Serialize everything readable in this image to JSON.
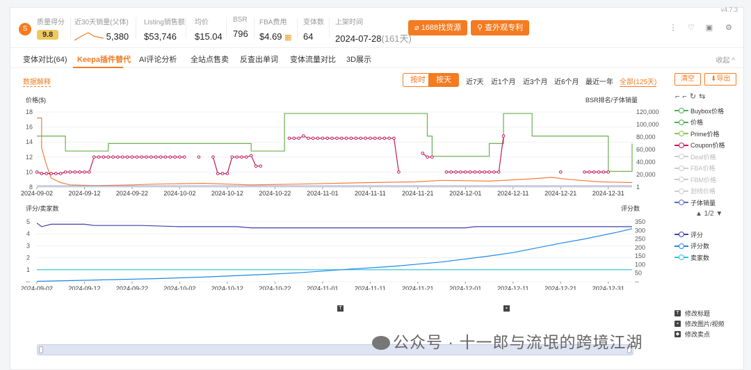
{
  "version": "v4.7.3",
  "stats": {
    "quality": {
      "label": "质量得分",
      "value": "9.8"
    },
    "sales30": {
      "label": "近30天销量(父体)",
      "value": "5,380"
    },
    "listing_sales": {
      "label": "Listing销售额",
      "value": "$53,746"
    },
    "avg_price": {
      "label": "均价",
      "value": "$15.04"
    },
    "bsr": {
      "label": "BSR",
      "value": "796"
    },
    "fba": {
      "label": "FBA费用",
      "value": "$4.69"
    },
    "variants": {
      "label": "变体数",
      "value": "64"
    },
    "launch": {
      "label": "上架时间",
      "value": "2024-07-28",
      "days": "(161天)"
    }
  },
  "buttons": {
    "source": "1688找货源",
    "patent": "查外观专利"
  },
  "icons": [
    "more-icon",
    "heart-icon",
    "video-icon",
    "settings-icon"
  ],
  "tabs": [
    {
      "label": "变体对比(64)",
      "active": false
    },
    {
      "label": "Keepa插件替代",
      "active": true
    },
    {
      "label": "AI评论分析",
      "active": false
    },
    {
      "label": "全站点售卖",
      "active": false
    },
    {
      "label": "反查出单词",
      "active": false
    },
    {
      "label": "变体流量对比",
      "active": false
    },
    {
      "label": "3D展示",
      "active": false
    }
  ],
  "collapse": "收起 ^",
  "toolbar": {
    "data_explain": "数据解释",
    "by_hour": "按时",
    "by_day": "按天",
    "ranges": [
      "近7天",
      "近1个月",
      "近3个月",
      "近6个月",
      "最近一年",
      "全部(125天)"
    ],
    "clear": "清空",
    "export": "导出"
  },
  "chart_data": [
    {
      "type": "line",
      "ylabel": "价格($)",
      "y2label": "BSR排名/子体销量",
      "ylim": [
        8,
        18
      ],
      "y_ticks": [
        8,
        10,
        12,
        14,
        16,
        18
      ],
      "y2_ticks": [
        "1",
        "20,000",
        "40,000",
        "60,000",
        "80,000",
        "100,000",
        "120,000"
      ],
      "x_ticks": [
        "2024-09-02",
        "2024-09-12",
        "2024-09-22",
        "2024-10-02",
        "2024-10-12",
        "2024-10-22",
        "2024-11-01",
        "2024-11-11",
        "2024-11-21",
        "2024-12-01",
        "2024-12-11",
        "2024-12-21",
        "2024-12-31"
      ],
      "series": [
        {
          "name": "Buybox价格",
          "color": "#4caf50",
          "visible": true
        },
        {
          "name": "价格",
          "color": "#4caf50",
          "visible": true
        },
        {
          "name": "Prime价格",
          "color": "#8bc34a",
          "visible": true
        },
        {
          "name": "Coupon价格",
          "color": "#c2185b",
          "visible": true
        },
        {
          "name": "Deal价格",
          "color": "#bbbbbb",
          "visible": false
        },
        {
          "name": "FBA价格",
          "color": "#bbbbbb",
          "visible": false
        },
        {
          "name": "FBM价格",
          "color": "#bbbbbb",
          "visible": false
        },
        {
          "name": "划线价格",
          "color": "#bbbbbb",
          "visible": false
        },
        {
          "name": "子体销量",
          "color": "#5c6bc0",
          "visible": true
        }
      ],
      "green_price": [
        [
          0,
          14.8
        ],
        [
          6,
          14.8
        ],
        [
          6,
          12.8
        ],
        [
          15,
          12.8
        ],
        [
          15,
          13.8
        ],
        [
          45,
          13.8
        ],
        [
          45,
          12.8
        ],
        [
          52,
          12.8
        ],
        [
          52,
          17.8
        ],
        [
          82,
          17.8
        ],
        [
          82,
          14.8
        ],
        [
          83,
          14.8
        ],
        [
          83,
          12.1
        ],
        [
          95,
          12.1
        ],
        [
          95,
          13.8
        ],
        [
          98,
          13.8
        ],
        [
          98,
          17.8
        ],
        [
          104,
          17.8
        ],
        [
          104,
          14.8
        ],
        [
          120,
          14.8
        ],
        [
          120,
          10.1
        ],
        [
          125,
          10.1
        ],
        [
          125,
          13.8
        ]
      ],
      "coupon_segments": [
        [
          [
            0,
            10
          ],
          [
            1,
            9.8
          ],
          [
            2,
            9.8
          ],
          [
            3,
            9.8
          ],
          [
            4,
            9.8
          ],
          [
            5,
            9.8
          ],
          [
            6,
            10
          ],
          [
            7,
            10
          ],
          [
            8,
            10
          ],
          [
            9,
            10
          ],
          [
            10,
            10
          ],
          [
            11,
            10
          ],
          [
            12,
            12
          ],
          [
            13,
            12
          ],
          [
            14,
            12
          ],
          [
            15,
            12
          ],
          [
            16,
            12
          ],
          [
            17,
            12
          ],
          [
            18,
            12
          ],
          [
            19,
            12
          ],
          [
            20,
            12
          ],
          [
            21,
            12
          ],
          [
            22,
            12
          ],
          [
            23,
            12
          ],
          [
            24,
            12
          ],
          [
            25,
            12
          ],
          [
            26,
            12
          ],
          [
            27,
            12
          ],
          [
            28,
            12
          ],
          [
            29,
            12
          ],
          [
            30,
            12
          ],
          [
            31,
            12
          ]
        ],
        [
          [
            34,
            12
          ]
        ],
        [
          [
            37,
            12
          ],
          [
            38,
            9.8
          ],
          [
            39,
            9.8
          ],
          [
            40,
            9.8
          ],
          [
            41,
            12
          ],
          [
            42,
            12
          ],
          [
            43,
            12
          ],
          [
            44,
            12
          ],
          [
            45,
            12.2
          ],
          [
            46,
            10.8
          ],
          [
            47,
            10.8
          ]
        ],
        [
          [
            53,
            14.5
          ],
          [
            54,
            14.5
          ],
          [
            55,
            14.5
          ],
          [
            56,
            14.8
          ],
          [
            57,
            14.5
          ],
          [
            58,
            14.5
          ],
          [
            59,
            14.5
          ],
          [
            60,
            14.5
          ],
          [
            61,
            14.5
          ],
          [
            62,
            14.5
          ],
          [
            63,
            14.5
          ],
          [
            64,
            14.5
          ],
          [
            65,
            14.5
          ],
          [
            66,
            14.5
          ],
          [
            67,
            14.5
          ],
          [
            68,
            14.5
          ],
          [
            69,
            14.5
          ],
          [
            70,
            14.5
          ],
          [
            71,
            14.5
          ],
          [
            72,
            14.5
          ],
          [
            73,
            14.5
          ],
          [
            74,
            14.5
          ],
          [
            75,
            14.5
          ],
          [
            76,
            10
          ]
        ],
        [
          [
            81,
            12.5
          ],
          [
            82,
            12
          ],
          [
            83,
            12
          ]
        ],
        [
          [
            86,
            10
          ],
          [
            87,
            10
          ],
          [
            88,
            10
          ],
          [
            89,
            10
          ],
          [
            90,
            10
          ],
          [
            91,
            10
          ],
          [
            92,
            10
          ],
          [
            93,
            10
          ],
          [
            94,
            10
          ],
          [
            95,
            10
          ],
          [
            96,
            10
          ],
          [
            97,
            10
          ],
          [
            98,
            14.8
          ]
        ],
        [
          [
            110,
            10
          ]
        ],
        [
          [
            115,
            10
          ],
          [
            116,
            10
          ],
          [
            117,
            10
          ],
          [
            118,
            10
          ],
          [
            119,
            10
          ],
          [
            120,
            10
          ]
        ]
      ],
      "orange_price": [
        [
          0,
          17.2
        ],
        [
          1,
          17.2
        ],
        [
          1,
          13.2
        ],
        [
          2,
          11
        ],
        [
          3,
          9.2
        ],
        [
          5,
          8.6
        ],
        [
          7,
          8.3
        ],
        [
          12,
          8.2
        ],
        [
          20,
          8.3
        ],
        [
          25,
          8.4
        ],
        [
          35,
          8.5
        ],
        [
          45,
          8.3
        ],
        [
          55,
          8.4
        ],
        [
          70,
          8.6
        ],
        [
          80,
          8.7
        ],
        [
          85,
          8.9
        ],
        [
          95,
          8.8
        ],
        [
          104,
          9.1
        ],
        [
          108,
          9.3
        ],
        [
          112,
          9
        ],
        [
          118,
          8.7
        ],
        [
          125,
          8.6
        ]
      ]
    },
    {
      "type": "line",
      "ylabel": "评分/卖家数",
      "y2label": "评分数",
      "ylim": [
        0,
        5
      ],
      "y_ticks": [
        "--",
        "1",
        "2",
        "3",
        "4",
        "5"
      ],
      "y2_ticks": [
        "--",
        "50",
        "100",
        "150",
        "200",
        "250",
        "300",
        "350"
      ],
      "x_ticks": [
        "2024-09-02",
        "2024-09-12",
        "2024-09-22",
        "2024-10-02",
        "2024-10-12",
        "2024-10-22",
        "2024-11-01",
        "2024-11-11",
        "2024-11-21",
        "2024-12-01",
        "2024-12-11",
        "2024-12-21",
        "2024-12-31"
      ],
      "series": [
        {
          "name": "评分",
          "color": "#3f3fa8"
        },
        {
          "name": "评分数",
          "color": "#1e88e5"
        },
        {
          "name": "卖家数",
          "color": "#26c6da"
        }
      ],
      "rating": [
        [
          0,
          4.9
        ],
        [
          1,
          4.6
        ],
        [
          3,
          4.8
        ],
        [
          10,
          4.8
        ],
        [
          12,
          4.7
        ],
        [
          22,
          4.7
        ],
        [
          30,
          4.6
        ],
        [
          42,
          4.6
        ],
        [
          45,
          4.5
        ],
        [
          90,
          4.5
        ],
        [
          92,
          4.6
        ],
        [
          125,
          4.6
        ]
      ],
      "review_count": [
        [
          0,
          2
        ],
        [
          10,
          8
        ],
        [
          25,
          18
        ],
        [
          35,
          27
        ],
        [
          50,
          45
        ],
        [
          55,
          52
        ],
        [
          65,
          72
        ],
        [
          75,
          90
        ],
        [
          85,
          115
        ],
        [
          95,
          150
        ],
        [
          100,
          170
        ],
        [
          110,
          225
        ],
        [
          115,
          250
        ],
        [
          122,
          290
        ],
        [
          125,
          310
        ]
      ],
      "sellers": [
        [
          0,
          1
        ],
        [
          125,
          1
        ]
      ]
    }
  ],
  "pager": "1/2",
  "edits": [
    "修改标题",
    "修改图片/视频",
    "修改卖点"
  ],
  "watermark": "公众号 · 十一郎与流氓的跨境江湖"
}
